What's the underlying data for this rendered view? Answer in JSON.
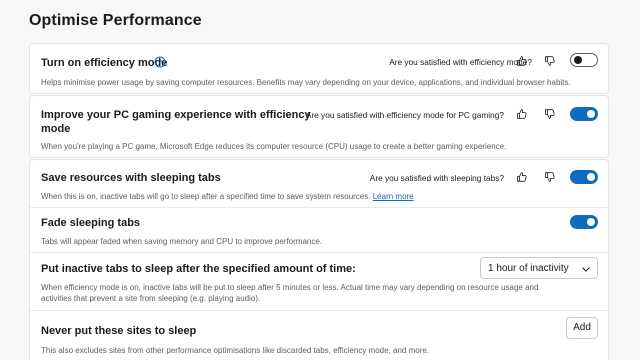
{
  "page": {
    "title": "Optimise Performance"
  },
  "efficiency": {
    "title": "Turn on efficiency mode",
    "description": "Helps minimise power usage by saving computer resources. Benefits may vary depending on your device, applications, and individual browser habits.",
    "question": "Are you satisfied with efficiency mode?",
    "toggle_on": false
  },
  "gaming": {
    "title_line1": "Improve your PC gaming experience with efficiency",
    "title_line2": "mode",
    "description": "When you're playing a PC game, Microsoft Edge reduces its computer resource (CPU) usage to create a better gaming experience.",
    "question": "Are you satisfied with efficiency mode for PC gaming?",
    "toggle_on": true
  },
  "sleeping": {
    "title": "Save resources with sleeping tabs",
    "description": "When this is on, inactive tabs will go to sleep after a specified time to save system resources.",
    "learn_more": "Learn more",
    "question": "Are you satisfied with sleeping tabs?",
    "toggle_on": true
  },
  "fade": {
    "title": "Fade sleeping tabs",
    "description": "Tabs will appear faded when saving memory and CPU to improve performance.",
    "toggle_on": true
  },
  "inactive": {
    "title": "Put inactive tabs to sleep after the specified amount of time:",
    "description_line1": "When efficiency mode is on, inactive tabs will be put to sleep after 5 minutes or less. Actual time may vary depending on resource usage and",
    "description_line2": "activities that prevent a site from sleeping (e.g. playing audio).",
    "dropdown_value": "1 hour of inactivity"
  },
  "never_sleep": {
    "title": "Never put these sites to sleep",
    "description": "This also excludes sites from other performance optimisations like discarded tabs, efficiency mode, and more.",
    "add_label": "Add"
  },
  "colors": {
    "accent": "#0f6cbd",
    "background": "#f7f7f7",
    "card": "#ffffff"
  },
  "icons": [
    "help-icon",
    "thumbs-up-icon",
    "thumbs-down-icon",
    "chevron-down-icon"
  ]
}
